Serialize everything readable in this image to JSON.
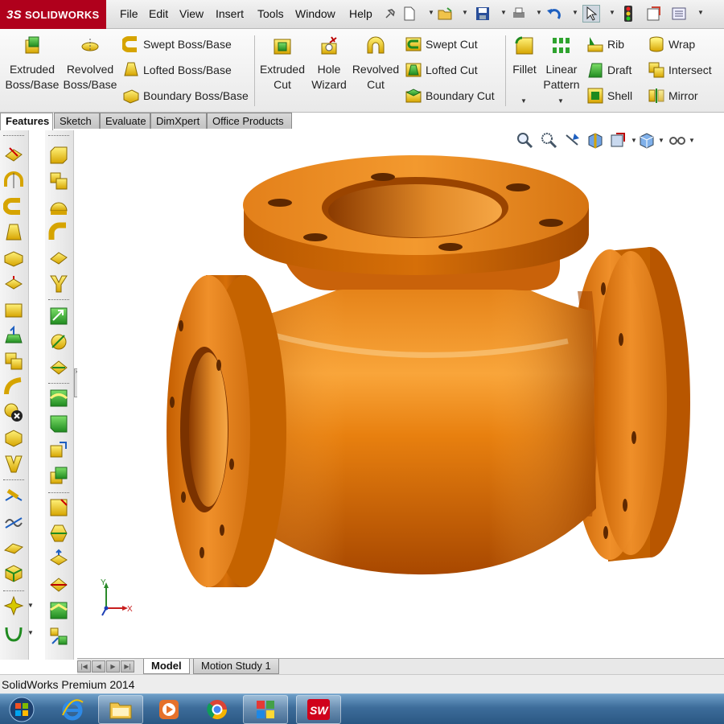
{
  "app": {
    "brand": "SOLIDWORKS",
    "brand_prefix": "3S"
  },
  "menu": [
    "File",
    "Edit",
    "View",
    "Insert",
    "Tools",
    "Window",
    "Help"
  ],
  "command_manager": {
    "extruded_boss": [
      "Extruded",
      "Boss/Base"
    ],
    "revolved_boss": [
      "Revolved",
      "Boss/Base"
    ],
    "swept_boss": "Swept Boss/Base",
    "lofted_boss": "Lofted Boss/Base",
    "boundary_boss": "Boundary Boss/Base",
    "extruded_cut": [
      "Extruded",
      "Cut"
    ],
    "hole_wizard": [
      "Hole",
      "Wizard"
    ],
    "revolved_cut": [
      "Revolved",
      "Cut"
    ],
    "swept_cut": "Swept Cut",
    "lofted_cut": "Lofted Cut",
    "boundary_cut": "Boundary Cut",
    "fillet": "Fillet",
    "linear_pattern": [
      "Linear",
      "Pattern"
    ],
    "rib": "Rib",
    "draft": "Draft",
    "shell": "Shell",
    "wrap": "Wrap",
    "intersect": "Intersect",
    "mirror": "Mirror"
  },
  "tabs": [
    "Features",
    "Sketch",
    "Evaluate",
    "DimXpert",
    "Office Products"
  ],
  "triad": {
    "y": "Y",
    "x": "X"
  },
  "bottom_tabs": [
    "Model",
    "Motion Study 1"
  ],
  "status": "SolidWorks Premium 2014",
  "colors": {
    "model": "#e87d10",
    "brand": "#b0001c",
    "taskbar": "#3d6c9a"
  },
  "icons": {
    "taskbar": [
      "windows-start-icon",
      "internet-explorer-icon",
      "file-explorer-icon",
      "media-player-icon",
      "chrome-icon",
      "apps-icon",
      "solidworks-icon"
    ]
  }
}
